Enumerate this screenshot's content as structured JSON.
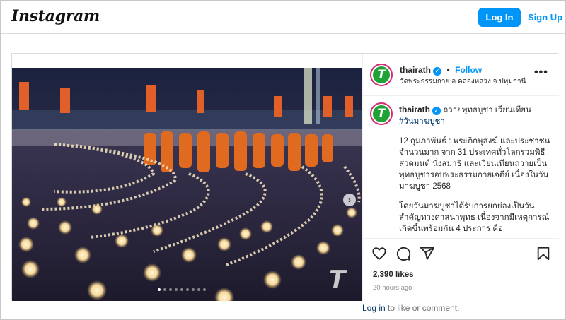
{
  "app": {
    "logo": "Instagram"
  },
  "header": {
    "login_label": "Log In",
    "signup_label": "Sign Up"
  },
  "post": {
    "username": "thairath",
    "follow_label": "Follow",
    "location": "วัดพระธรรมกาย อ.คลองหลวง จ.ปทุมธานี",
    "caption": {
      "title": "ถวายพุทธบูชา เวียนเทียน",
      "hashtag": "#วันมาฆบูชา",
      "para1": "12 กุมภาพันธ์ : พระภิกษุสงฆ์ และประชาชนจำนวนมาก จาก 31 ประเทศทั่วโลกร่วมพิธีสวดมนต์ นั่งสมาธิ และเวียนเทียนถวายเป็นพุทธบูชารอบพระธรรมกายเจดีย์ เนื่องในวันมาฆบูชา 2568",
      "para2": "โดยวันมาฆบูชาได้รับการยกย่องเป็นวันสำคัญทางศาสนาพุทธ เนื่องจากมีเหตุการณ์เกิดขึ้นพร้อมกัน 4 ประการ คือ"
    },
    "likes": "2,390 likes",
    "time": "20 hours ago",
    "carousel": {
      "slides": 9,
      "active_index": 0
    },
    "watermark": "T",
    "avatar_glyph": "T"
  },
  "footer": {
    "login_link": "Log in",
    "rest": " to like or comment."
  },
  "colors": {
    "accent": "#0095f6",
    "avatar_green": "#1fa336",
    "ring": "#d62976"
  },
  "icons": [
    "more-options-icon",
    "heart-icon",
    "comment-icon",
    "share-icon",
    "bookmark-icon",
    "verified-badge-icon",
    "next-arrow-icon"
  ]
}
